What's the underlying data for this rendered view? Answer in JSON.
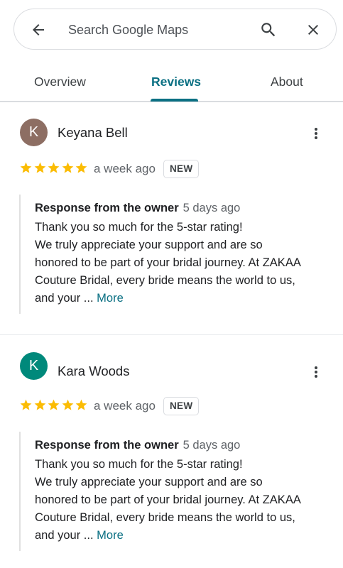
{
  "search": {
    "placeholder": "Search Google Maps",
    "back_icon": "arrow-back-icon",
    "search_icon": "search-icon",
    "close_icon": "close-icon"
  },
  "tabs": [
    {
      "label": "Overview",
      "active": false
    },
    {
      "label": "Reviews",
      "active": true
    },
    {
      "label": "About",
      "active": false
    }
  ],
  "colors": {
    "accent": "#0b7083",
    "star": "#fbbc04",
    "avatar_1": "#8d6e63",
    "avatar_2": "#00897b"
  },
  "reviews": [
    {
      "avatar_letter": "K",
      "name": "Keyana Bell",
      "rating": 5,
      "date": "a week ago",
      "badge": "NEW",
      "response": {
        "title": "Response from the owner",
        "date": "5 days ago",
        "lines": [
          "Thank you so much for the 5-star rating!",
          "We truly appreciate your support and are so",
          "honored to be part of your bridal journey. At ZAKAA",
          "Couture Bridal, every bride means the world to us,",
          "and your ..."
        ],
        "more_label": "More"
      }
    },
    {
      "avatar_letter": "K",
      "name": "Kara Woods",
      "rating": 5,
      "date": "a week ago",
      "badge": "NEW",
      "response": {
        "title": "Response from the owner",
        "date": "5 days ago",
        "lines": [
          "Thank you so much for the 5-star rating!",
          "We truly appreciate your support and are so",
          "honored to be part of your bridal journey. At ZAKAA",
          "Couture Bridal, every bride means the world to us,",
          "and your ..."
        ],
        "more_label": "More"
      }
    }
  ]
}
